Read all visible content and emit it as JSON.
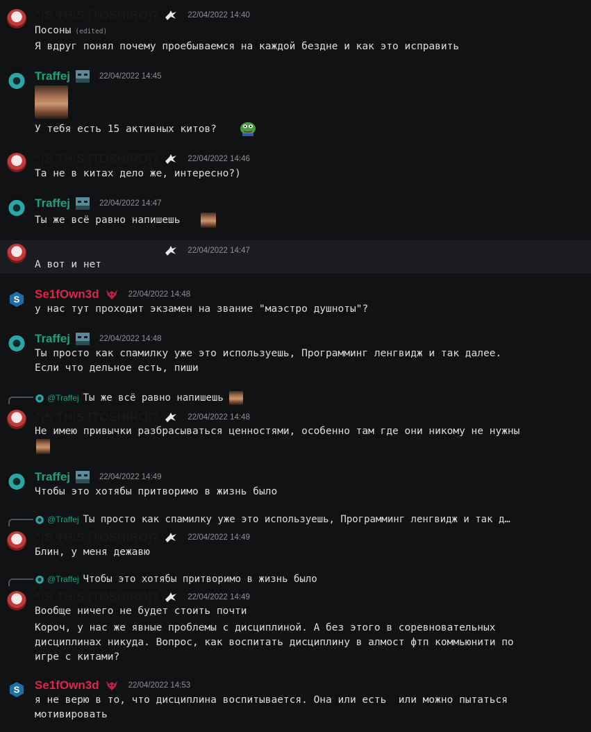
{
  "users": {
    "toshiro": "^¡S THIS [TOSHIRO]?",
    "traffej": "Traffej",
    "self": "Se1fOwn3d"
  },
  "messages": [
    {
      "time": "22/04/2022 14:40",
      "lines": [
        "Посоны",
        "Я вдруг понял почему проебываемся на каждой бездне и как это исправить"
      ],
      "edited": "(edited)"
    },
    {
      "time": "22/04/2022 14:45",
      "lines": [
        "У тебя есть 15 активных китов?"
      ]
    },
    {
      "time": "22/04/2022 14:46",
      "lines": [
        "Та не в китах дело же, интересно?)"
      ]
    },
    {
      "time": "22/04/2022 14:47",
      "lines": [
        "Ты же всё равно напишешь"
      ]
    },
    {
      "time": "22/04/2022 14:47",
      "lines": [
        "А вот и нет"
      ]
    },
    {
      "time": "22/04/2022 14:48",
      "lines": [
        "у нас тут проходит экзамен на звание \"маэстро душноты\"?"
      ]
    },
    {
      "time": "22/04/2022 14:48",
      "lines": [
        "Ты просто как спамилку уже это используешь, Программинг ленгвидж и так далее.",
        "Если что дельное есть, пиши"
      ]
    },
    {
      "time": "22/04/2022 14:48",
      "lines": [
        "Не имею привычки разбрасываться ценностями, особенно там где они никому не нужны"
      ],
      "reply": "Ты же всё равно напишешь"
    },
    {
      "time": "22/04/2022 14:49",
      "lines": [
        "Чтобы это хотябы притворимо в жизнь было"
      ]
    },
    {
      "time": "22/04/2022 14:49",
      "lines": [
        "Блин, у меня дежавю"
      ],
      "reply": "Ты просто как спамилку уже это используешь, Программинг ленгвидж и так д…"
    },
    {
      "time": "22/04/2022 14:49",
      "lines": [
        "Вообще ничего не будет стоить почти",
        "Короч, у нас же явные проблемы с дисциплиной. А без этого в соревновательных",
        "дисциплинах никуда. Вопрос, как воспитать дисциплину в алмост фтп коммьюнити по",
        "игре с китами?"
      ],
      "reply": "Чтобы это хотябы притворимо в жизнь было"
    },
    {
      "time": "22/04/2022 14:53",
      "lines": [
        "я не верю в то, что дисциплина воспитывается. Она или есть  или можно пытаться",
        "мотивировать"
      ]
    }
  ],
  "reply_mention": "@Traffej"
}
